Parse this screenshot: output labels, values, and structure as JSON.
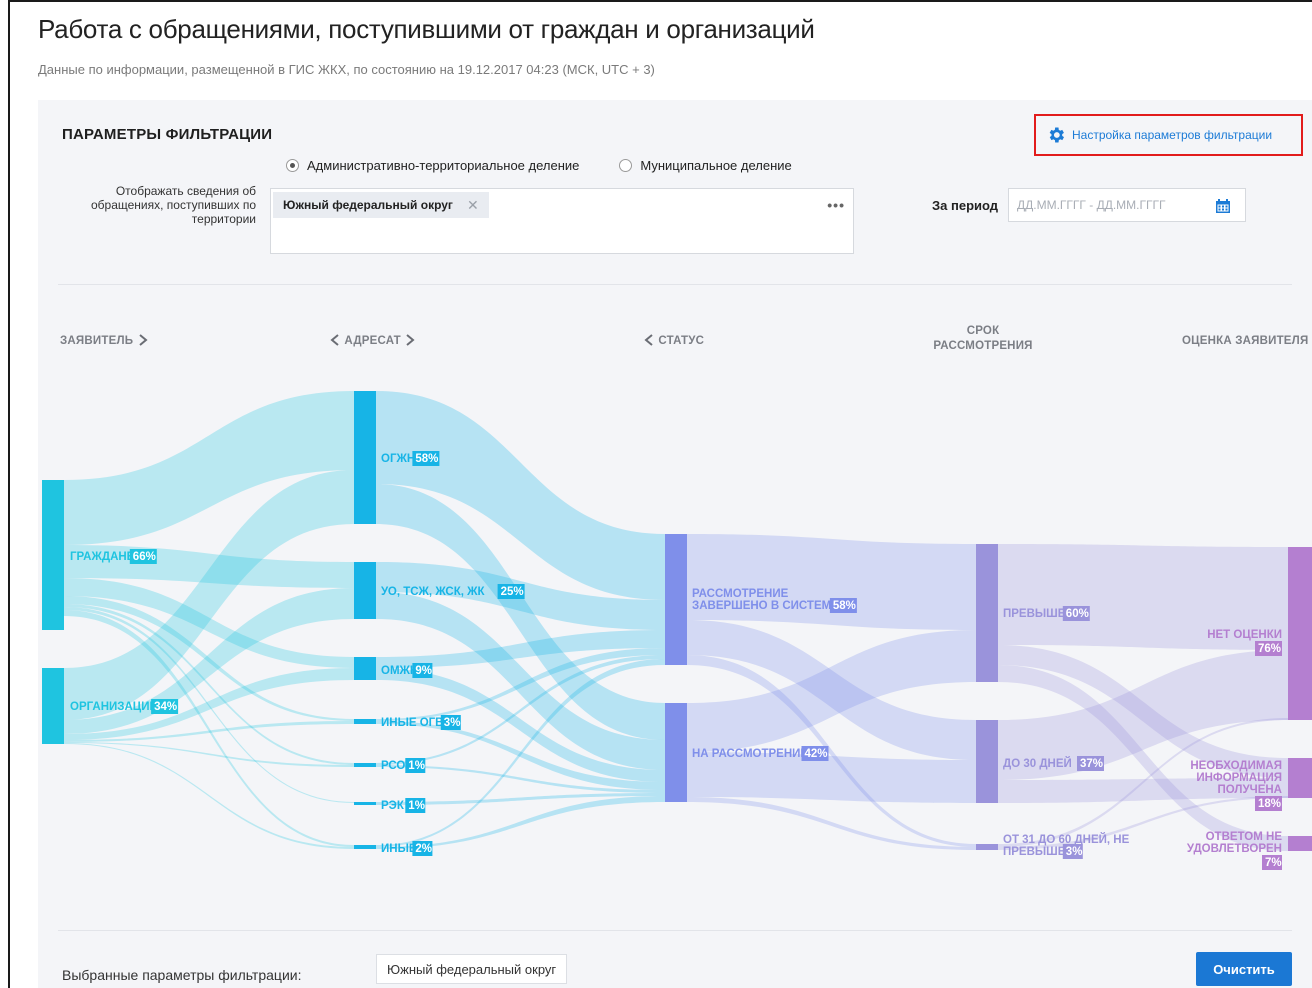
{
  "page": {
    "title": "Работа с обращениями, поступившими от граждан и организаций",
    "subtitle": "Данные по информации, размещенной в ГИС ЖКХ, по состоянию на 19.12.2017 04:23 (МСК, UTC + 3)"
  },
  "filters": {
    "title": "ПАРАМЕТРЫ ФИЛЬТРАЦИИ",
    "settings_link": "Настройка параметров фильтрации",
    "radio_admin": "Административно-территориальное деление",
    "radio_municipal": "Муниципальное деление",
    "radio_selected": "admin",
    "territory_label": "Отображать сведения об обращениях, поступивших по территории",
    "territory_tag": "Южный федеральный округ",
    "territory_more": "•••",
    "period_label": "За период",
    "period_placeholder": "ДД.ММ.ГГГГ - ДД.ММ.ГГГГ"
  },
  "columns": {
    "applicant": "ЗАЯВИТЕЛЬ",
    "addressee": "АДРЕСАТ",
    "status": "СТАТУС",
    "term_line1": "СРОК",
    "term_line2": "РАССМОТРЕНИЯ",
    "rating": "ОЦЕНКА ЗАЯВИТЕЛЯ"
  },
  "colors": {
    "applicant": "#1fc4e0",
    "addressee": "#17b4e6",
    "status": "#7f8fea",
    "term": "#9a93db",
    "rating": "#b47fd0",
    "link": "#1c7bd6",
    "button": "#1b78d4"
  },
  "chart_data": {
    "type": "sankey",
    "nodes": [
      {
        "id": "citizens",
        "stage": "applicant",
        "label": "ГРАЖДАНЕ",
        "pct": "66%"
      },
      {
        "id": "orgs",
        "stage": "applicant",
        "label": "ОРГАНИЗАЦИИ",
        "pct": "34%"
      },
      {
        "id": "ogzh",
        "stage": "addressee",
        "label": "ОГЖН",
        "pct": "58%"
      },
      {
        "id": "uo",
        "stage": "addressee",
        "label": "УО, ТСЖ, ЖСК, ЖК",
        "pct": "25%"
      },
      {
        "id": "omzhk",
        "stage": "addressee",
        "label": "ОМЖК",
        "pct": "9%"
      },
      {
        "id": "ogv",
        "stage": "addressee",
        "label": "ИНЫЕ ОГВ",
        "pct": "3%"
      },
      {
        "id": "rso",
        "stage": "addressee",
        "label": "РСО",
        "pct": "1%"
      },
      {
        "id": "rek",
        "stage": "addressee",
        "label": "РЭК",
        "pct": "1%"
      },
      {
        "id": "other",
        "stage": "addressee",
        "label": "ИНЫЕ",
        "pct": "2%"
      },
      {
        "id": "done",
        "stage": "status",
        "label": "РАССМОТРЕНИЕ ЗАВЕРШЕНО В СИСТЕМЕ",
        "pct": "58%"
      },
      {
        "id": "review",
        "stage": "status",
        "label": "НА РАССМОТРЕНИИ",
        "pct": "42%"
      },
      {
        "id": "exceeded",
        "stage": "term",
        "label": "ПРЕВЫШЕН",
        "pct": "60%"
      },
      {
        "id": "d30",
        "stage": "term",
        "label": "ДО 30 ДНЕЙ",
        "pct": "37%"
      },
      {
        "id": "d3160",
        "stage": "term",
        "label": "ОТ 31 ДО 60 ДНЕЙ, НЕ ПРЕВЫШЕН",
        "pct": "3%"
      },
      {
        "id": "norating",
        "stage": "rating",
        "label": "НЕТ ОЦЕНКИ",
        "pct": "76%"
      },
      {
        "id": "received",
        "stage": "rating",
        "label": "НЕОБХОДИМАЯ ИНФОРМАЦИЯ ПОЛУЧЕНА",
        "pct": "18%"
      },
      {
        "id": "unsatisfied",
        "stage": "rating",
        "label": "ОТВЕТОМ НЕ УДОВЛЕТВОРЕН",
        "pct": "7%"
      }
    ]
  },
  "bottom": {
    "selected_label": "Выбранные параметры фильтрации:",
    "selected_chip": "Южный федеральный округ",
    "clear_button": "Очистить"
  }
}
